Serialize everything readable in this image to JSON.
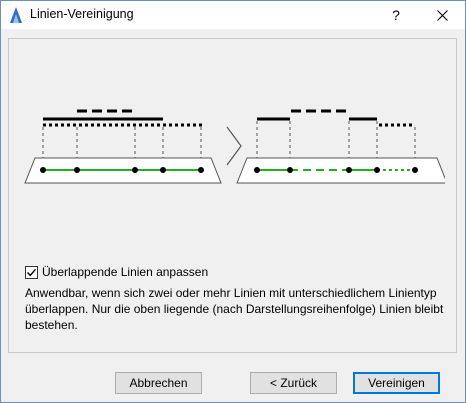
{
  "window": {
    "title": "Linien-Vereinigung",
    "help_label": "?"
  },
  "option": {
    "checked": true,
    "label": "Überlappende Linien anpassen"
  },
  "description": "Anwendbar, wenn sich zwei oder mehr Linien mit unterschiedlichem Linientyp überlappen. Nur die oben liegende (nach Darstellungsreihenfolge) Linien bleibt bestehen.",
  "buttons": {
    "cancel": "Abbrechen",
    "back": "< Zurück",
    "merge": "Vereinigen"
  },
  "colors": {
    "accent": "#0078d7",
    "line_green": "#1db31d",
    "app_icon_blue": "#2d6fc5"
  }
}
